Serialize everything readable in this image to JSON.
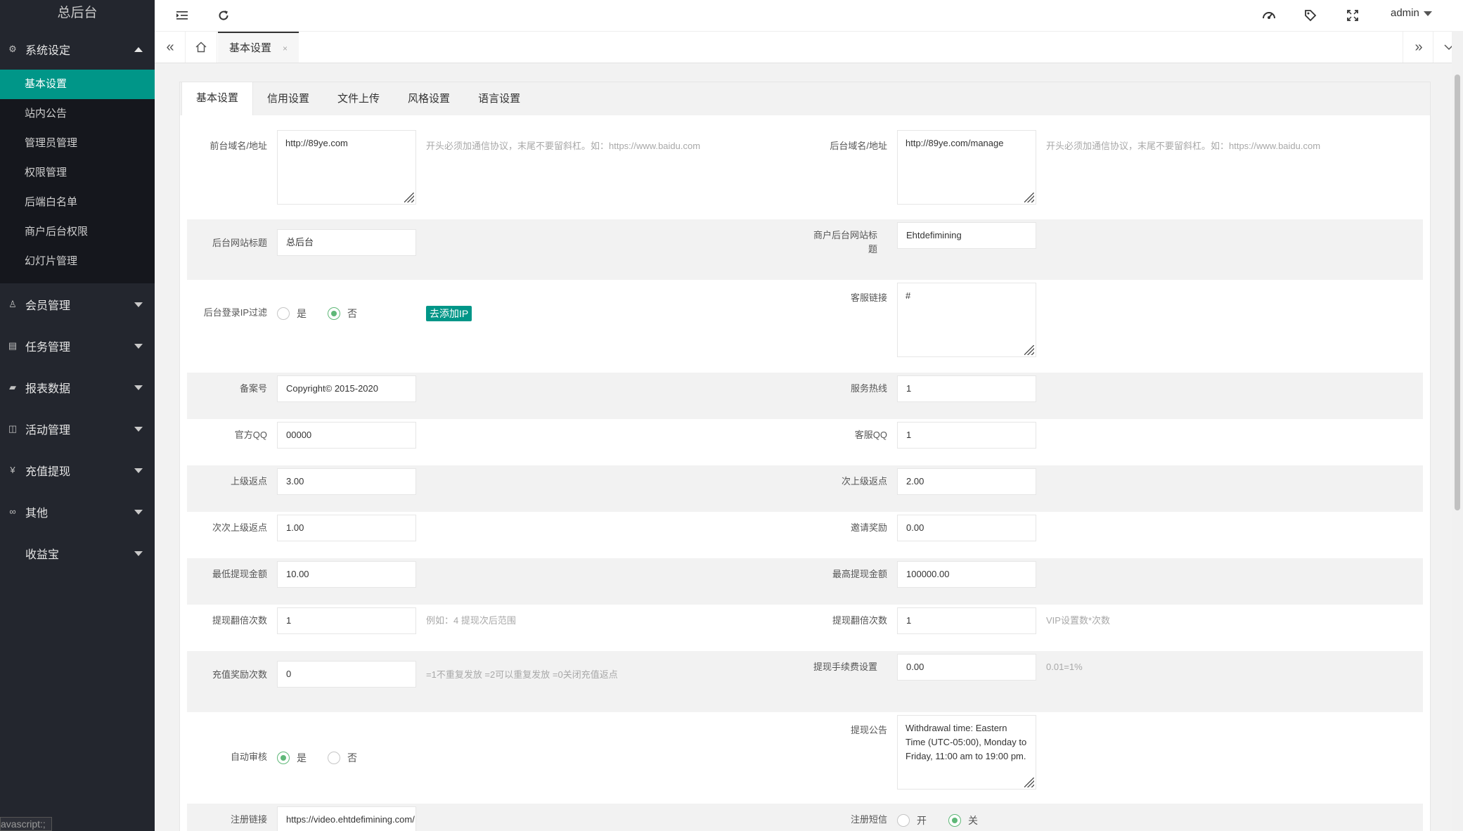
{
  "sidebar": {
    "logo": "总后台",
    "system": {
      "label": "系统设定",
      "icon": "gear-icon"
    },
    "system_items": [
      "基本设置",
      "站内公告",
      "管理员管理",
      "权限管理",
      "后端白名单",
      "商户后台权限",
      "幻灯片管理"
    ],
    "groups": [
      {
        "label": "会员管理",
        "icon": "user-icon",
        "glyph": "♙"
      },
      {
        "label": "任务管理",
        "icon": "document-icon",
        "glyph": "▤"
      },
      {
        "label": "报表数据",
        "icon": "chat-icon",
        "glyph": "▰"
      },
      {
        "label": "活动管理",
        "icon": "book-icon",
        "glyph": "◫"
      },
      {
        "label": "充值提现",
        "icon": "yen-icon",
        "glyph": "¥"
      },
      {
        "label": "其他",
        "icon": "link-icon",
        "glyph": "∞"
      },
      {
        "label": "收益宝",
        "icon": "",
        "glyph": ""
      }
    ],
    "status_text": "avascript:;"
  },
  "header": {
    "user": "admin"
  },
  "tabbar": {
    "tab": "基本设置",
    "close": "×"
  },
  "settings_tabs": [
    "基本设置",
    "信用设置",
    "文件上传",
    "风格设置",
    "语言设置"
  ],
  "form": {
    "front_domain": {
      "label": "前台域名/地址",
      "value": "http://89ye.com",
      "hint": "开头必须加通信协议，末尾不要留斜杠。如：https://www.baidu.com"
    },
    "admin_domain": {
      "label": "后台域名/地址",
      "value": "http://89ye.com/manage",
      "hint": "开头必须加通信协议，末尾不要留斜杠。如：https://www.baidu.com"
    },
    "admin_title": {
      "label": "后台网站标题",
      "value": "总后台"
    },
    "merchant_title": {
      "label": "商户后台网站标题",
      "value": "Ehtdefimining"
    },
    "ip_filter": {
      "label": "后台登录IP过滤",
      "yes": "是",
      "no": "否",
      "selected": "否",
      "button": "去添加IP"
    },
    "service_link": {
      "label": "客服链接",
      "value": "#"
    },
    "icp": {
      "label": "备案号",
      "value": "Copyright© 2015-2020"
    },
    "hotline": {
      "label": "服务热线",
      "value": "1"
    },
    "official_qq": {
      "label": "官方QQ",
      "value": "00000"
    },
    "service_qq": {
      "label": "客服QQ",
      "value": "1"
    },
    "upline_rebate": {
      "label": "上级返点",
      "value": "3.00"
    },
    "second_rebate": {
      "label": "次上级返点",
      "value": "2.00"
    },
    "third_rebate": {
      "label": "次次上级返点",
      "value": "1.00"
    },
    "invite_reward": {
      "label": "邀请奖励",
      "value": "0.00"
    },
    "min_withdraw": {
      "label": "最低提现金额",
      "value": "10.00"
    },
    "max_withdraw": {
      "label": "最高提现金额",
      "value": "100000.00"
    },
    "withdraw_multiple": {
      "label": "提现翻倍次数",
      "value": "1",
      "hint": "例如：4 提现次后范围"
    },
    "withdraw_multiple2": {
      "label": "提现翻倍次数",
      "value": "1",
      "hint": "VIP设置数*次数"
    },
    "recharge_reward": {
      "label": "充值奖励次数",
      "value": "0",
      "hint": "=1不重复发放 =2可以重复发放 =0关闭充值返点"
    },
    "withdraw_fee": {
      "label": "提现手续费设置",
      "value": "0.00",
      "hint": "0.01=1%"
    },
    "auto_review": {
      "label": "自动审核",
      "yes": "是",
      "no": "否",
      "selected": "是"
    },
    "withdraw_notice": {
      "label": "提现公告",
      "value": "Withdrawal time: Eastern Time (UTC-05:00), Monday to Friday, 11:00 am to 19:00 pm."
    },
    "register_link": {
      "label": "注册链接",
      "value": "https://video.ehtdefimining.com/"
    },
    "register_sms": {
      "label": "注册短信",
      "on": "开",
      "off": "关",
      "selected": "关"
    }
  }
}
